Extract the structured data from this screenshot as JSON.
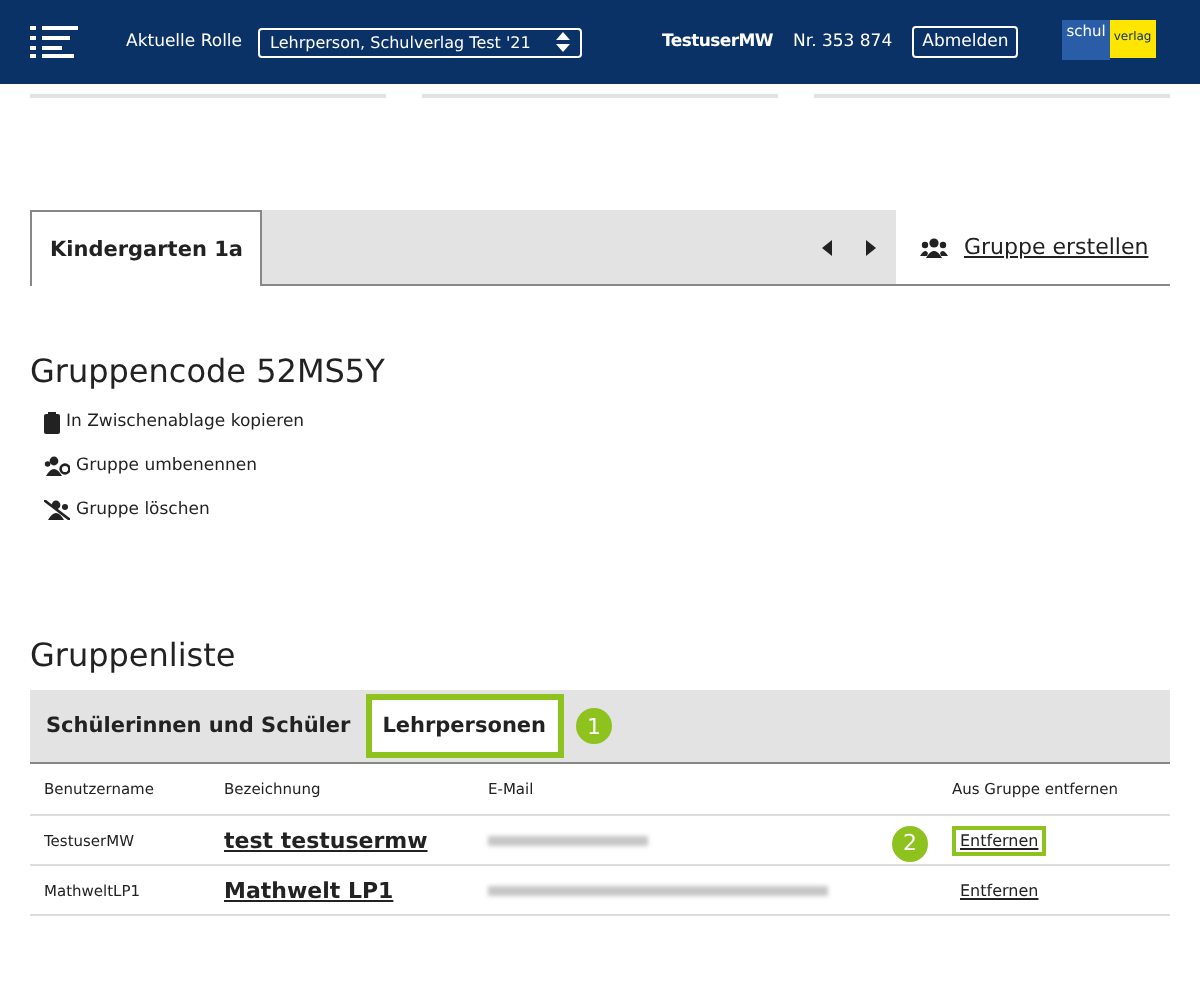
{
  "header": {
    "role_label": "Aktuelle Rolle",
    "role_value": "Lehrperson, Schulverlag Test '21",
    "user": "TestuserMW",
    "number": "Nr. 353 874",
    "logout": "Abmelden",
    "logo": [
      "schul",
      "verlag"
    ]
  },
  "group_tabs": [
    {
      "label": "Kindergarten 1a",
      "selected": true
    }
  ],
  "create_group": "Gruppe erstellen",
  "code_title": "Gruppencode 52MS5Y",
  "actions": [
    {
      "kind": "copy",
      "label": "In Zwischenablage kopieren"
    },
    {
      "kind": "rename",
      "label": "Gruppe umbenennen"
    },
    {
      "kind": "delete",
      "label": "Gruppe löschen"
    }
  ],
  "list_title": "Gruppenliste",
  "list_tabs": [
    {
      "label": "Schülerinnen und Schüler",
      "selected": false,
      "highlighted": false
    },
    {
      "label": "Lehrpersonen",
      "selected": true,
      "highlighted": true,
      "callout": "1"
    }
  ],
  "table": {
    "columns": [
      "Benutzername",
      "Bezeichnung",
      "E-Mail",
      "Aus Gruppe entfernen"
    ],
    "rows": [
      {
        "username": "TestuserMW",
        "name": "test testusermw",
        "remove": "Entfernen",
        "highlighted": true,
        "callout": "2"
      },
      {
        "username": "MathweltLP1",
        "name": "Mathwelt LP1",
        "remove": "Entfernen",
        "highlighted": false
      }
    ]
  }
}
